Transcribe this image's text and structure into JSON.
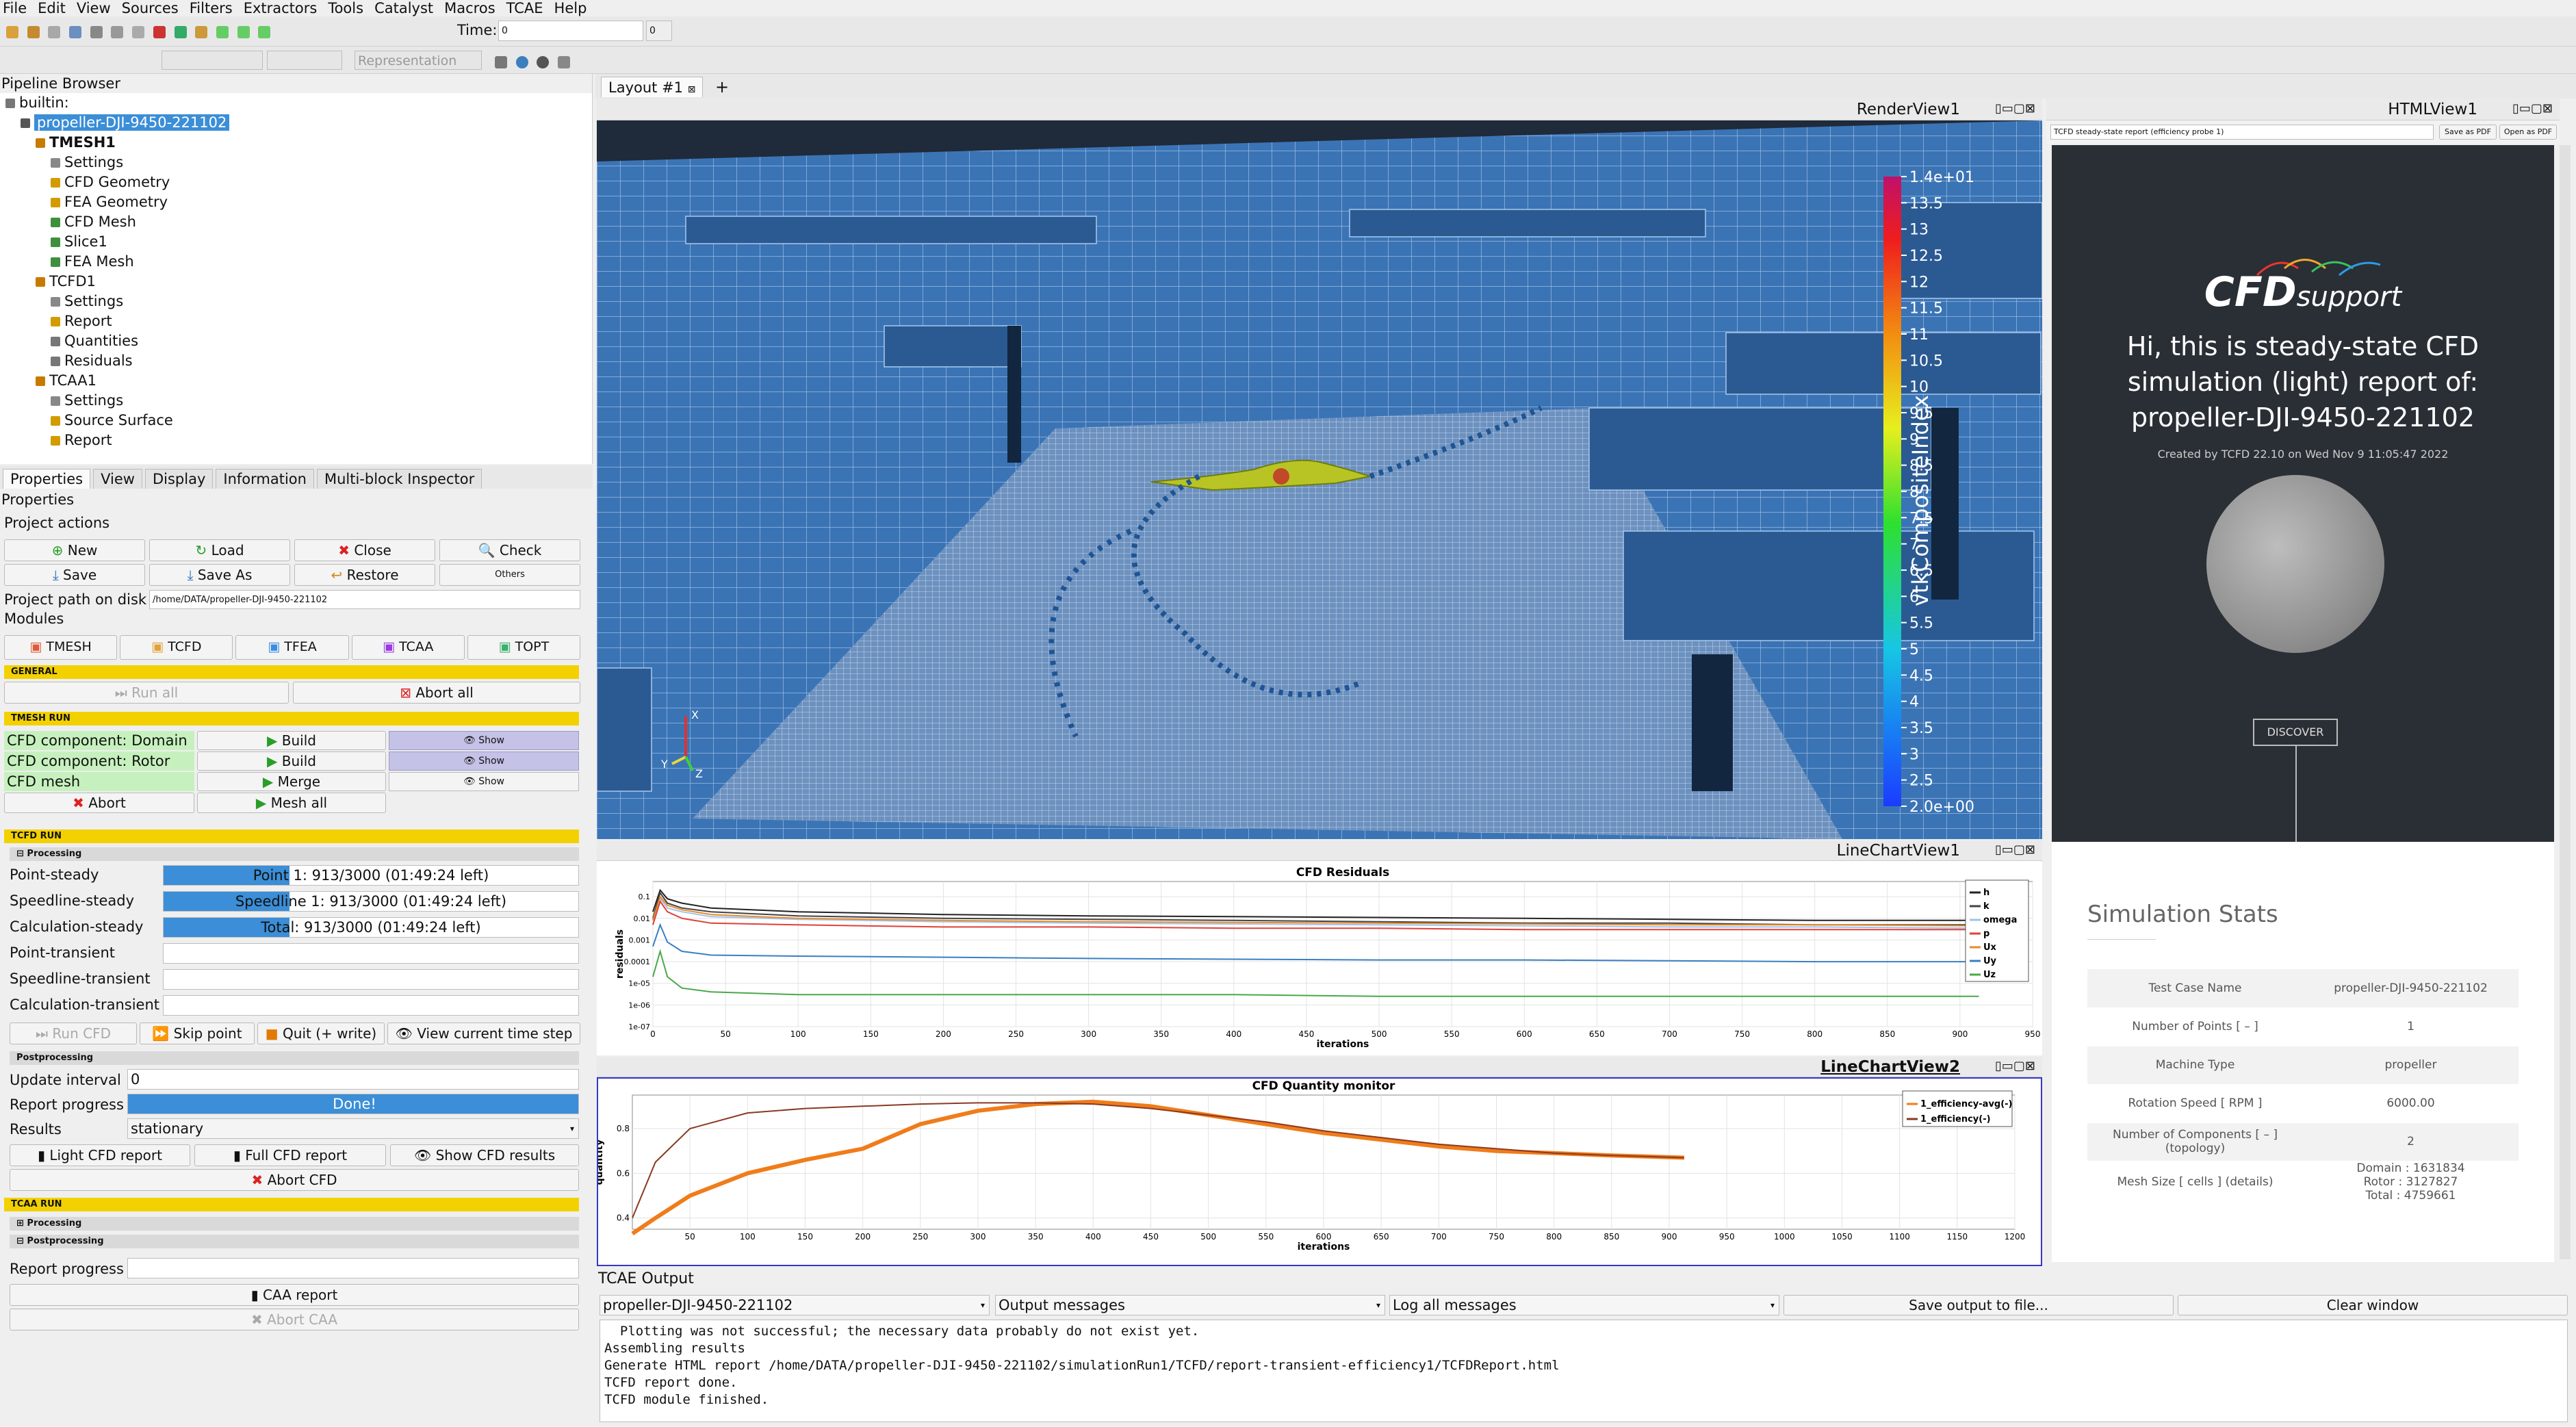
{
  "menu": [
    "File",
    "Edit",
    "View",
    "Sources",
    "Filters",
    "Extractors",
    "Tools",
    "Catalyst",
    "Macros",
    "TCAE",
    "Help"
  ],
  "toolbar": {
    "time_label": "Time:",
    "time_value": "0",
    "time_index": "0",
    "representation": "Representation"
  },
  "pipeline": {
    "title": "Pipeline Browser",
    "items": [
      {
        "label": "builtin:",
        "indent": 0,
        "color": "#777"
      },
      {
        "label": "propeller-DJI-9450-221102",
        "indent": 1,
        "color": "#555",
        "selected": true
      },
      {
        "label": "TMESH1",
        "indent": 2,
        "color": "#c77a00",
        "bold": true
      },
      {
        "label": "Settings",
        "indent": 3,
        "color": "#888"
      },
      {
        "label": "CFD Geometry",
        "indent": 3,
        "color": "#d29b00"
      },
      {
        "label": "FEA Geometry",
        "indent": 3,
        "color": "#d29b00"
      },
      {
        "label": "CFD Mesh",
        "indent": 3,
        "color": "#3f8f3f"
      },
      {
        "label": "Slice1",
        "indent": 3,
        "color": "#3f8f3f"
      },
      {
        "label": "FEA Mesh",
        "indent": 3,
        "color": "#3f8f3f"
      },
      {
        "label": "TCFD1",
        "indent": 2,
        "color": "#c77a00"
      },
      {
        "label": "Settings",
        "indent": 3,
        "color": "#888"
      },
      {
        "label": "Report",
        "indent": 3,
        "color": "#d29b00"
      },
      {
        "label": "Quantities",
        "indent": 3,
        "color": "#777"
      },
      {
        "label": "Residuals",
        "indent": 3,
        "color": "#777"
      },
      {
        "label": "TCAA1",
        "indent": 2,
        "color": "#c77a00"
      },
      {
        "label": "Settings",
        "indent": 3,
        "color": "#888"
      },
      {
        "label": "Source Surface",
        "indent": 3,
        "color": "#d29b00"
      },
      {
        "label": "Report",
        "indent": 3,
        "color": "#d29b00"
      }
    ]
  },
  "tabs": [
    "Properties",
    "View",
    "Display",
    "Information",
    "Multi-block Inspector"
  ],
  "properties": {
    "title": "Properties",
    "project_actions": "Project actions",
    "buttons": {
      "new": "New",
      "load": "Load",
      "close": "Close",
      "check": "Check",
      "save": "Save",
      "save_as": "Save As",
      "restore": "Restore",
      "others": "Others"
    },
    "path_label": "Project path on disk",
    "path_value": "/home/DATA/propeller-DJI-9450-221102",
    "modules_label": "Modules",
    "modules": [
      "TMESH",
      "TCFD",
      "TFEA",
      "TCAA",
      "TOPT"
    ],
    "general": "GENERAL",
    "run_all": "Run all",
    "abort_all": "Abort all",
    "tmesh_run": "TMESH RUN",
    "components": [
      {
        "label": "CFD component: Domain",
        "action": "Build",
        "show": "Show"
      },
      {
        "label": "CFD component: Rotor",
        "action": "Build",
        "show": "Show"
      },
      {
        "label": "CFD mesh",
        "action": "Merge",
        "show": "Show"
      }
    ],
    "abort": "Abort",
    "mesh_all": "Mesh all",
    "tcfd_run": "TCFD RUN",
    "processing": "Processing",
    "runs": [
      {
        "label": "Point-steady",
        "text": "Point 1: 913/3000 (01:49:24 left)",
        "progress": 0.3043
      },
      {
        "label": "Speedline-steady",
        "text": "Speedline 1: 913/3000 (01:49:24 left)",
        "progress": 0.3043
      },
      {
        "label": "Calculation-steady",
        "text": "Total: 913/3000 (01:49:24 left)",
        "progress": 0.3043
      },
      {
        "label": "Point-transient",
        "text": "",
        "progress": 0
      },
      {
        "label": "Speedline-transient",
        "text": "",
        "progress": 0
      },
      {
        "label": "Calculation-transient",
        "text": "",
        "progress": 0
      }
    ],
    "run_cfd": "Run CFD",
    "skip_point": "Skip point",
    "quit_write": "Quit (+ write)",
    "view_current": "View current time step",
    "postprocessing": "Postprocessing",
    "update_interval_label": "Update interval",
    "update_interval": "0",
    "report_progress_label": "Report progress",
    "report_done": "Done!",
    "results_label": "Results",
    "results_value": "stationary",
    "light_report": "Light CFD report",
    "full_report": "Full CFD report",
    "show_results": "Show CFD results",
    "abort_cfd": "Abort CFD",
    "tcaa_run": "TCAA RUN",
    "caa_report": "CAA report",
    "abort_caa": "Abort CAA"
  },
  "layout_tab": "Layout #1",
  "render_view": {
    "title": "RenderView1",
    "colorbar_title": "vtkCompositeIndex",
    "colorbar_ticks": [
      "1.4e+01",
      "13.5",
      "13",
      "12.5",
      "12",
      "11.5",
      "11",
      "10.5",
      "10",
      "9.5",
      "9",
      "8.5",
      "8",
      "7.5",
      "7",
      "6.5",
      "6",
      "5.5",
      "5",
      "4.5",
      "4",
      "3.5",
      "3",
      "2.5",
      "2.0e+00"
    ],
    "axis_x": "X",
    "axis_y": "Y",
    "axis_z": "Z"
  },
  "html_view": {
    "title": "HTMLView1",
    "select": "TCFD steady-state report (efficiency probe 1)",
    "save_pdf": "Save as PDF",
    "open_pdf": "Open as PDF",
    "logo_cfd": "CFD",
    "logo_support": "support",
    "headline": "Hi, this is steady-state CFD simulation (light) report of: propeller-DJI-9450-221102",
    "created": "Created by TCFD 22.10 on Wed Nov 9 11:05:47 2022",
    "discover": "DISCOVER",
    "stats_title": "Simulation Stats",
    "stats": [
      {
        "k": "Test Case Name",
        "v": "propeller-DJI-9450-221102"
      },
      {
        "k": "Number of Points [ – ]",
        "v": "1"
      },
      {
        "k": "Machine Type",
        "v": "propeller"
      },
      {
        "k": "Rotation Speed [ RPM ]",
        "v": "6000.00"
      },
      {
        "k": "Number of Components [ – ] (topology)",
        "v": "2"
      },
      {
        "k": "Mesh Size [ cells ] (details)",
        "v": "Domain : 1631834 | Rotor : 3127827 | Total : 4759661"
      }
    ]
  },
  "chart_data": [
    {
      "type": "line",
      "view": "LineChartView1",
      "title": "CFD Residuals",
      "xlabel": "iterations",
      "ylabel": "residuals",
      "yscale": "log",
      "xlim": [
        0,
        950
      ],
      "yticks": [
        "0.1",
        "0.01",
        "0.001",
        "0.0001",
        "1e-05",
        "1e-06",
        "1e-07"
      ],
      "xticks": [
        0,
        50,
        100,
        150,
        200,
        250,
        300,
        350,
        400,
        450,
        500,
        550,
        600,
        650,
        700,
        750,
        800,
        850,
        900,
        950
      ],
      "x": [
        0,
        5,
        10,
        20,
        40,
        100,
        200,
        300,
        400,
        500,
        600,
        700,
        800,
        913
      ],
      "series": [
        {
          "name": "h",
          "color": "#222222",
          "values": [
            0.02,
            0.2,
            0.08,
            0.05,
            0.03,
            0.02,
            0.015,
            0.013,
            0.012,
            0.011,
            0.01,
            0.009,
            0.008,
            0.008
          ]
        },
        {
          "name": "k",
          "color": "#444444",
          "values": [
            0.01,
            0.15,
            0.05,
            0.03,
            0.02,
            0.013,
            0.01,
            0.009,
            0.008,
            0.007,
            0.006,
            0.006,
            0.005,
            0.005
          ]
        },
        {
          "name": "omega",
          "color": "#9fc4e8",
          "values": [
            0.005,
            0.08,
            0.03,
            0.02,
            0.012,
            0.009,
            0.007,
            0.006,
            0.0055,
            0.005,
            0.0045,
            0.004,
            0.004,
            0.0035
          ]
        },
        {
          "name": "p",
          "color": "#e0413a",
          "values": [
            0.005,
            0.06,
            0.02,
            0.01,
            0.006,
            0.005,
            0.004,
            0.004,
            0.0035,
            0.0035,
            0.003,
            0.003,
            0.003,
            0.003
          ]
        },
        {
          "name": "Ux",
          "color": "#e88a2e",
          "values": [
            0.008,
            0.1,
            0.04,
            0.025,
            0.015,
            0.01,
            0.008,
            0.007,
            0.0065,
            0.006,
            0.0055,
            0.005,
            0.005,
            0.0045
          ]
        },
        {
          "name": "Uy",
          "color": "#3a7fc4",
          "values": [
            0.0005,
            0.005,
            0.0008,
            0.0003,
            0.0002,
            0.00018,
            0.00016,
            0.00014,
            0.00013,
            0.00012,
            0.00012,
            0.00011,
            0.0001,
            0.0001
          ]
        },
        {
          "name": "Uz",
          "color": "#4aa84a",
          "values": [
            2e-05,
            0.0003,
            2e-05,
            6e-06,
            4e-06,
            3e-06,
            3e-06,
            3e-06,
            3e-06,
            2.5e-06,
            2.5e-06,
            2.5e-06,
            2.5e-06,
            2.5e-06
          ]
        }
      ]
    },
    {
      "type": "line",
      "view": "LineChartView2",
      "title": "CFD Quantity monitor",
      "xlabel": "iterations",
      "ylabel": "quantity",
      "xlim": [
        0,
        1200
      ],
      "ylim": [
        0.35,
        0.95
      ],
      "xticks": [
        50,
        100,
        150,
        200,
        250,
        300,
        350,
        400,
        450,
        500,
        550,
        600,
        650,
        700,
        750,
        800,
        850,
        900,
        950,
        1000,
        1050,
        1100,
        1150,
        1200
      ],
      "yticks": [
        0.4,
        0.6,
        0.8
      ],
      "x": [
        0,
        20,
        50,
        100,
        150,
        200,
        250,
        300,
        350,
        400,
        450,
        500,
        550,
        600,
        650,
        700,
        750,
        800,
        850,
        913
      ],
      "series": [
        {
          "name": "1_efficiency-avg(-)",
          "color": "#f07c1a",
          "values": [
            0.33,
            0.4,
            0.5,
            0.6,
            0.66,
            0.71,
            0.82,
            0.88,
            0.91,
            0.92,
            0.9,
            0.86,
            0.82,
            0.78,
            0.75,
            0.72,
            0.7,
            0.69,
            0.68,
            0.67
          ]
        },
        {
          "name": "1_efficiency(-)",
          "color": "#8a3a22",
          "values": [
            0.4,
            0.65,
            0.8,
            0.87,
            0.89,
            0.9,
            0.91,
            0.915,
            0.915,
            0.91,
            0.89,
            0.86,
            0.83,
            0.79,
            0.76,
            0.73,
            0.71,
            0.69,
            0.68,
            0.67
          ]
        }
      ]
    }
  ],
  "output": {
    "title": "TCAE Output",
    "source": "propeller-DJI-9450-221102",
    "mode": "Output messages",
    "level": "Log all messages",
    "save": "Save output to file...",
    "clear": "Clear window",
    "lines": [
      "  Plotting was not successful; the necessary data probably do not exist yet.",
      "Assembling results",
      "Generate HTML report /home/DATA/propeller-DJI-9450-221102/simulationRun1/TCFD/report-transient-efficiency1/TCFDReport.html",
      "TCFD report done.",
      "TCFD module finished."
    ]
  },
  "colors": {
    "accent": "#3b8ed7",
    "yellow": "#f3d100",
    "green": "#c6f1be",
    "purple": "#c4c2e6",
    "render_bg": "#1f2a3a",
    "mesh": "#3b74b5"
  }
}
